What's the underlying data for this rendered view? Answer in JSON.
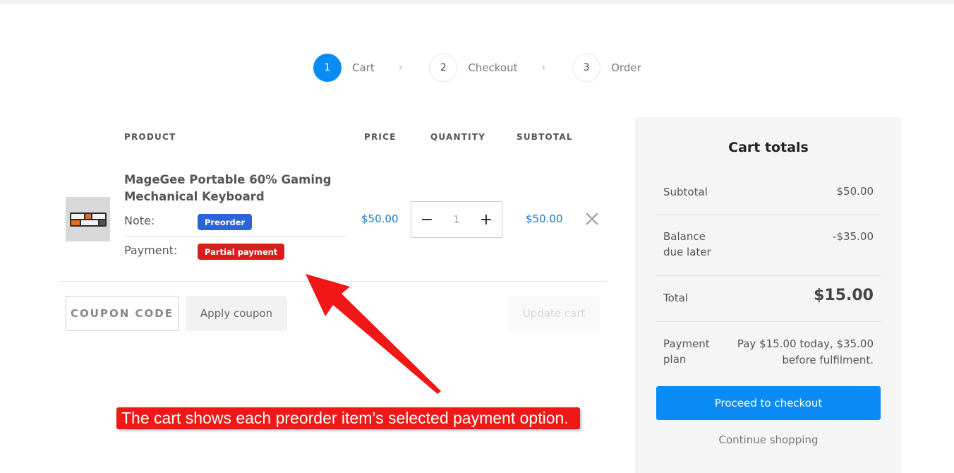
{
  "steps": [
    {
      "number": "1",
      "label": "Cart",
      "active": true
    },
    {
      "number": "2",
      "label": "Checkout",
      "active": false
    },
    {
      "number": "3",
      "label": "Order",
      "active": false
    }
  ],
  "step_separator": "›",
  "table": {
    "headers": {
      "product": "PRODUCT",
      "price": "PRICE",
      "quantity": "QUANTITY",
      "subtotal": "SUBTOTAL"
    }
  },
  "item": {
    "name": "MageGee Portable 60% Gaming Mechanical Keyboard",
    "note_label": "Note:",
    "note_badge": "Preorder",
    "payment_label": "Payment:",
    "payment_badge": "Partial payment",
    "price": "$50.00",
    "quantity": "1",
    "subtotal": "$50.00",
    "minus": "−",
    "plus": "+"
  },
  "coupon": {
    "placeholder": "COUPON CODE",
    "apply_label": "Apply coupon",
    "update_label": "Update cart"
  },
  "annotation": {
    "text": "The cart shows each preorder item’s selected payment option."
  },
  "totals": {
    "title": "Cart totals",
    "subtotal_label": "Subtotal",
    "subtotal_value": "$50.00",
    "balance_label": "Balance due later",
    "balance_value": "-$35.00",
    "total_label": "Total",
    "total_value": "$15.00",
    "plan_label": "Payment plan",
    "plan_value": "Pay $15.00 today, $35.00 before fulfilment.",
    "checkout_label": "Proceed to checkout",
    "continue_label": "Continue shopping"
  },
  "colors": {
    "accent": "#0a8bf5",
    "price": "#1977c8",
    "preorder_badge": "#2b63d9",
    "payment_badge": "#d91d1d",
    "annotation": "#f01717"
  }
}
